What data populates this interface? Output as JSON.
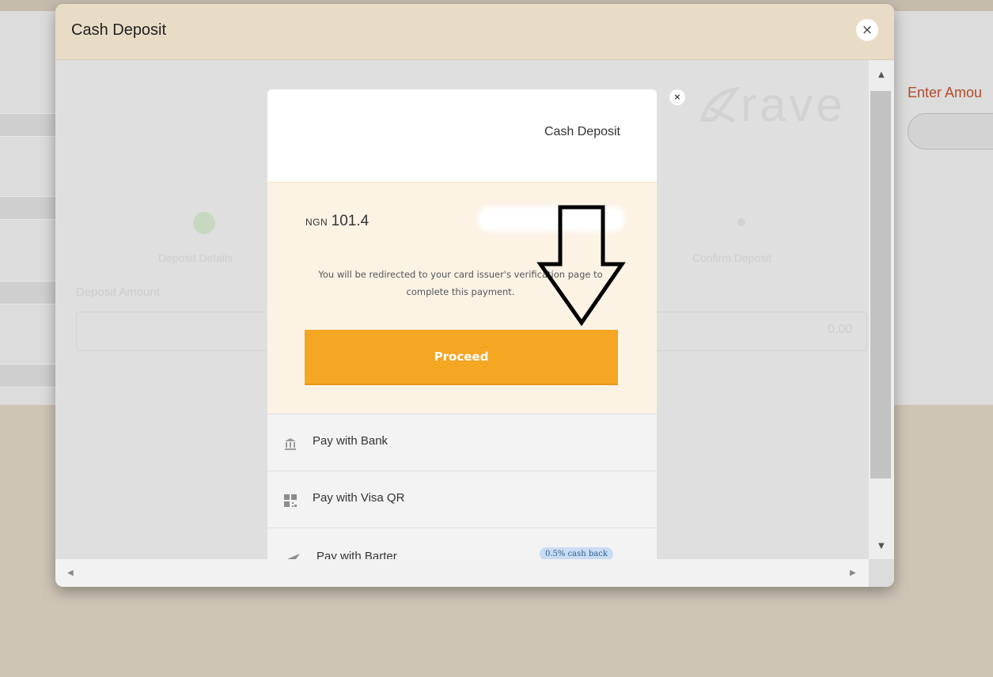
{
  "background": {
    "enter_amount_label": "Enter Amou"
  },
  "modal": {
    "title": "Cash Deposit",
    "close_symbol": "×",
    "scroll_up": "▲",
    "scroll_down": "▼",
    "scroll_left": "◀",
    "scroll_right": "▶"
  },
  "faded_wizard": {
    "step_left": "Deposit Details",
    "step_right": "Confirm Deposit",
    "field_label": "Deposit Amount",
    "field_value": "0.00"
  },
  "rave": {
    "logo_text": "rave",
    "close_symbol": "×",
    "header_title": "Cash Deposit",
    "currency": "NGN",
    "amount": "101.4",
    "redirect_message": "You will be redirected to your card issuer's verification page to complete this payment.",
    "proceed_label": "Proceed",
    "accent_color": "#f5a623",
    "methods": [
      {
        "label": "Pay with Bank",
        "icon": "bank-icon"
      },
      {
        "label": "Pay with Visa QR",
        "icon": "qr-code-icon"
      },
      {
        "label": "Pay with Barter",
        "icon": "barter-icon",
        "badge": "0.5% cash back"
      }
    ]
  },
  "annotation": {
    "icon": "down-arrow-icon",
    "color": "#000000"
  }
}
